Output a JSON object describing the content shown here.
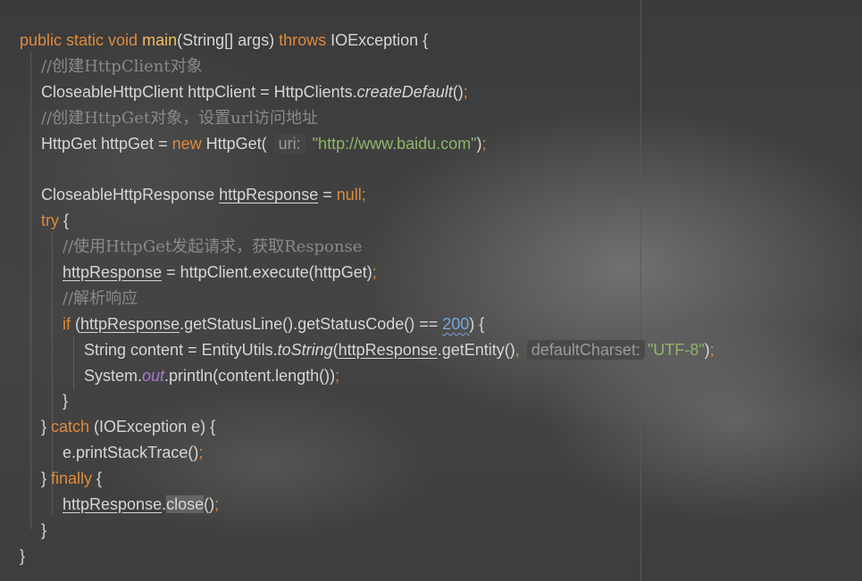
{
  "editor": {
    "lines": [
      {
        "indent": 0,
        "tokens": [
          {
            "t": "public static void ",
            "c": "kw"
          },
          {
            "t": "main",
            "c": "fn"
          },
          {
            "t": "(String[] args) "
          },
          {
            "t": "throws",
            "c": "kw"
          },
          {
            "t": " IOException {"
          }
        ]
      },
      {
        "indent": 1,
        "tokens": [
          {
            "t": "//创建HttpClient对象",
            "c": "cm"
          }
        ]
      },
      {
        "indent": 1,
        "tokens": [
          {
            "t": "CloseableHttpClient httpClient = HttpClients."
          },
          {
            "t": "createDefault",
            "c": "it"
          },
          {
            "t": "()"
          },
          {
            "t": ";",
            "c": "semi"
          }
        ]
      },
      {
        "indent": 1,
        "tokens": [
          {
            "t": "//创建HttpGet对象，设置url访问地址",
            "c": "cm"
          }
        ]
      },
      {
        "indent": 1,
        "tokens": [
          {
            "t": "HttpGet httpGet = "
          },
          {
            "t": "new",
            "c": "kw"
          },
          {
            "t": " HttpGet( "
          },
          {
            "t": "uri:",
            "c": "hint"
          },
          {
            "t": " "
          },
          {
            "t": "\"http://www.baidu.com\"",
            "c": "str"
          },
          {
            "t": ")"
          },
          {
            "t": ";",
            "c": "semi"
          }
        ]
      },
      {
        "indent": 0,
        "tokens": []
      },
      {
        "indent": 1,
        "tokens": [
          {
            "t": "CloseableHttpResponse "
          },
          {
            "t": "httpResponse",
            "c": "uvar"
          },
          {
            "t": " = "
          },
          {
            "t": "null",
            "c": "kw"
          },
          {
            "t": ";",
            "c": "semi"
          }
        ]
      },
      {
        "indent": 1,
        "tokens": [
          {
            "t": "try",
            "c": "kw"
          },
          {
            "t": " {"
          }
        ]
      },
      {
        "indent": 2,
        "tokens": [
          {
            "t": "//使用HttpGet发起请求，获取Response",
            "c": "cm"
          }
        ]
      },
      {
        "indent": 2,
        "tokens": [
          {
            "t": "httpResponse",
            "c": "uvar"
          },
          {
            "t": " = httpClient.execute(httpGet)"
          },
          {
            "t": ";",
            "c": "semi"
          }
        ]
      },
      {
        "indent": 2,
        "tokens": [
          {
            "t": "//解析响应",
            "c": "cm"
          }
        ]
      },
      {
        "indent": 2,
        "tokens": [
          {
            "t": "if",
            "c": "kw"
          },
          {
            "t": " ("
          },
          {
            "t": "httpResponse",
            "c": "uvar"
          },
          {
            "t": ".getStatusLine().getStatusCode() == "
          },
          {
            "t": "200",
            "c": "num"
          },
          {
            "t": ") {"
          }
        ]
      },
      {
        "indent": 3,
        "tokens": [
          {
            "t": "String content = EntityUtils."
          },
          {
            "t": "toString",
            "c": "it"
          },
          {
            "t": "("
          },
          {
            "t": "httpResponse",
            "c": "uvar"
          },
          {
            "t": ".getEntity()"
          },
          {
            "t": ",",
            "c": "semi"
          },
          {
            "t": " "
          },
          {
            "t": "defaultCharset:",
            "c": "hint"
          },
          {
            "t": "\"UTF-8\"",
            "c": "str"
          },
          {
            "t": ")"
          },
          {
            "t": ";",
            "c": "semi"
          }
        ]
      },
      {
        "indent": 3,
        "tokens": [
          {
            "t": "System."
          },
          {
            "t": "out",
            "c": "static"
          },
          {
            "t": ".println(content.length())"
          },
          {
            "t": ";",
            "c": "semi"
          }
        ]
      },
      {
        "indent": 2,
        "tokens": [
          {
            "t": "}"
          }
        ]
      },
      {
        "indent": 1,
        "tokens": [
          {
            "t": "} "
          },
          {
            "t": "catch",
            "c": "kw"
          },
          {
            "t": " (IOException e) {"
          }
        ]
      },
      {
        "indent": 2,
        "tokens": [
          {
            "t": "e.printStackTrace()"
          },
          {
            "t": ";",
            "c": "semi"
          }
        ]
      },
      {
        "indent": 1,
        "tokens": [
          {
            "t": "} "
          },
          {
            "t": "finally",
            "c": "kw"
          },
          {
            "t": " {"
          }
        ]
      },
      {
        "indent": 2,
        "tokens": [
          {
            "t": "httpResponse",
            "c": "uvar"
          },
          {
            "t": "."
          },
          {
            "t": "close",
            "c": "hl"
          },
          {
            "t": "()"
          },
          {
            "t": ";",
            "c": "semi"
          }
        ]
      },
      {
        "indent": 1,
        "tokens": [
          {
            "t": "}"
          }
        ]
      },
      {
        "indent": 0,
        "tokens": [
          {
            "t": "}"
          }
        ]
      }
    ]
  }
}
